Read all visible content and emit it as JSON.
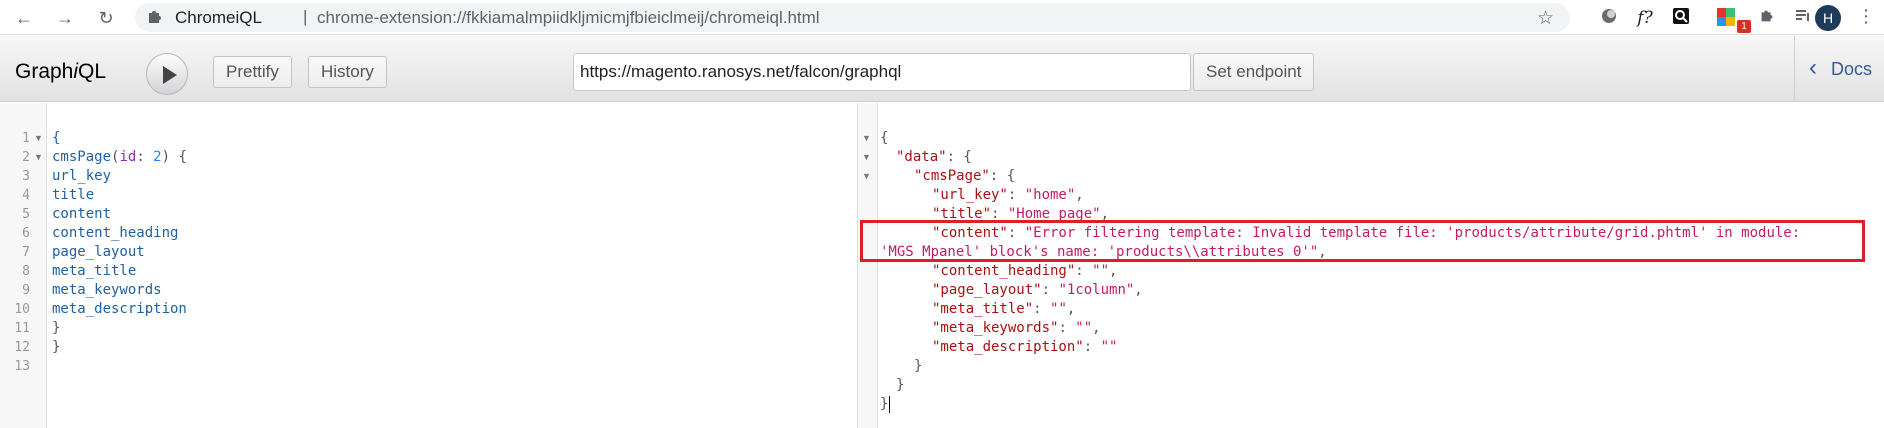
{
  "browser": {
    "site_label": "ChromeiQL",
    "separator": "|",
    "url": "chrome-extension://fkkiamalmpiidkljmicmjfbieiclmeij/chromeiql.html",
    "profile_initial": "H",
    "extension_badge": "1",
    "ext_func_label": "f?"
  },
  "toolbar": {
    "logo": "GraphiQL",
    "prettify_label": "Prettify",
    "history_label": "History",
    "endpoint_value": "https://magento.ranosys.net/falcon/graphql",
    "set_endpoint_label": "Set endpoint",
    "docs_label": "Docs"
  },
  "query": {
    "line_numbers": [
      "1",
      "2",
      "3",
      "4",
      "5",
      "6",
      "7",
      "8",
      "9",
      "10",
      "11",
      "12",
      "13"
    ],
    "lines": [
      "{",
      "cmsPage(id: 2) {",
      "url_key",
      "title",
      "content",
      "content_heading",
      "page_layout",
      "meta_title",
      "meta_keywords",
      "meta_description",
      "}",
      "}",
      ""
    ]
  },
  "result": {
    "open_brace": "{",
    "data_key": "\"data\"",
    "cmspage_key": "\"cmsPage\"",
    "url_key_key": "\"url_key\"",
    "url_key_val": "\"home\"",
    "title_key": "\"title\"",
    "title_val": "\"Home page\"",
    "content_key": "\"content\"",
    "content_val_line1": "\"Error filtering template: Invalid template file: 'products/attribute/grid.phtml' in module:",
    "content_val_line2": "'MGS_Mpanel' block's name: 'products\\\\attributes_0'\"",
    "content_heading_key": "\"content_heading\"",
    "content_heading_val": "\"\"",
    "page_layout_key": "\"page_layout\"",
    "page_layout_val": "\"1column\"",
    "meta_title_key": "\"meta_title\"",
    "meta_title_val": "\"\"",
    "meta_keywords_key": "\"meta_keywords\"",
    "meta_keywords_val": "\"\"",
    "meta_description_key": "\"meta_description\"",
    "meta_description_val": "\"\"",
    "close_inner": "}",
    "close_data": "}",
    "close_root": "}"
  },
  "colors": {
    "highlight_box": "#dd1f26",
    "key": "#a11",
    "string": "#c41a68"
  }
}
